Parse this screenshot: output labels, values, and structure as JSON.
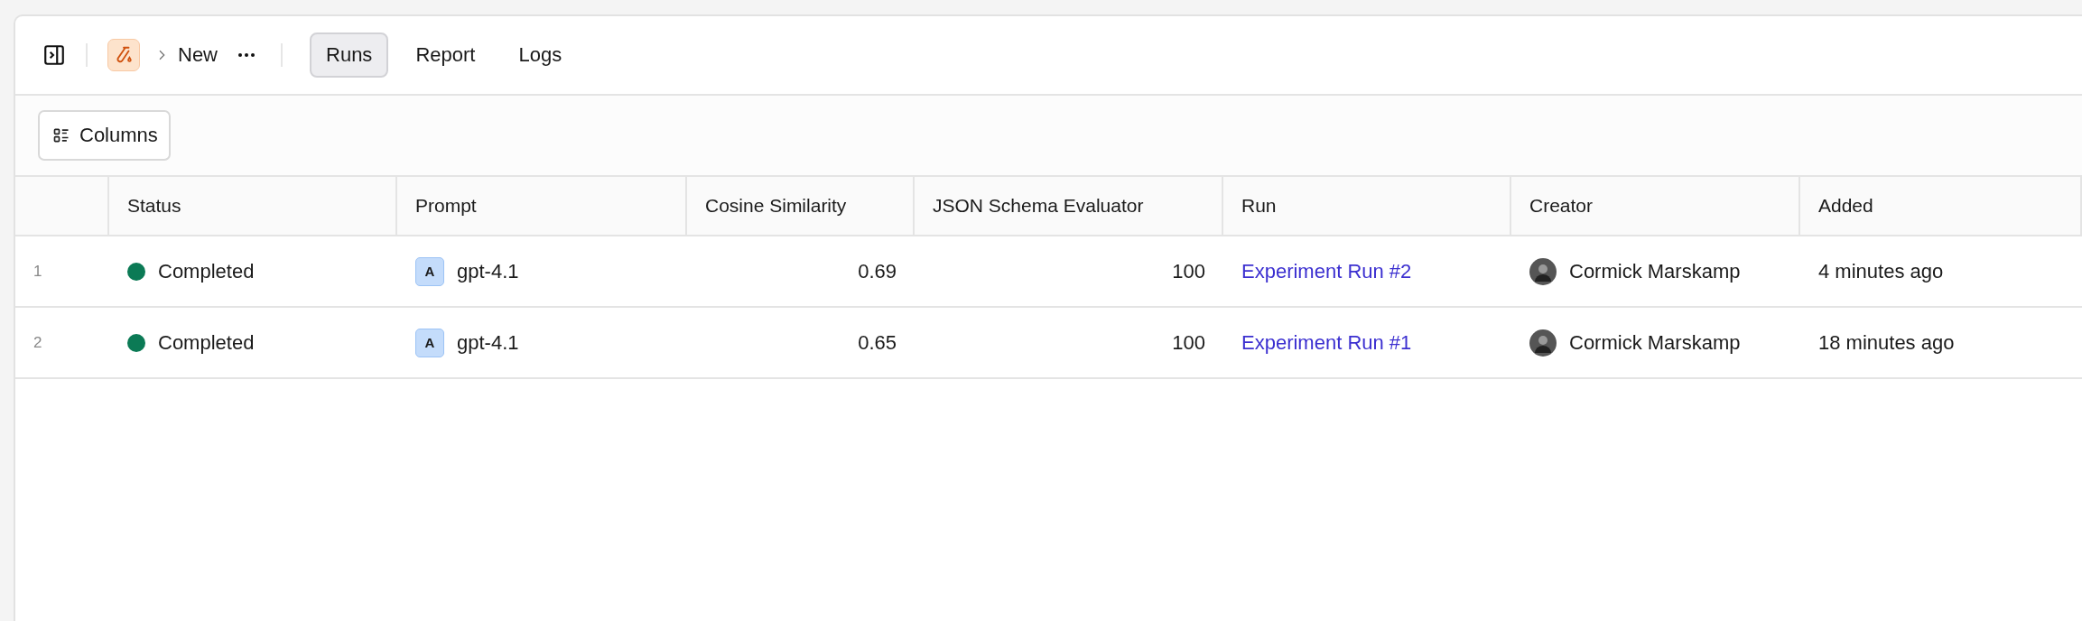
{
  "header": {
    "breadcrumb": "New",
    "tabs": [
      {
        "label": "Runs",
        "selected": true
      },
      {
        "label": "Report",
        "selected": false
      },
      {
        "label": "Logs",
        "selected": false
      }
    ]
  },
  "toolbar": {
    "columns_button": "Columns"
  },
  "table": {
    "columns": [
      "Status",
      "Prompt",
      "Cosine Similarity",
      "JSON Schema Evaluator",
      "Run",
      "Creator",
      "Added"
    ],
    "rows": [
      {
        "index": "1",
        "status": "Completed",
        "color": "#0b7a55",
        "prompt_badge": "A",
        "prompt": "gpt-4.1",
        "cosine": "0.69",
        "json_schema": "100",
        "run": "Experiment Run #2",
        "creator": "Cormick Marskamp",
        "added": "4 minutes ago"
      },
      {
        "index": "2",
        "status": "Completed",
        "color": "#0b7a55",
        "prompt_badge": "A",
        "prompt": "gpt-4.1",
        "cosine": "0.65",
        "json_schema": "100",
        "run": "Experiment Run #1",
        "creator": "Cormick Marskamp",
        "added": "18 minutes ago"
      }
    ]
  }
}
